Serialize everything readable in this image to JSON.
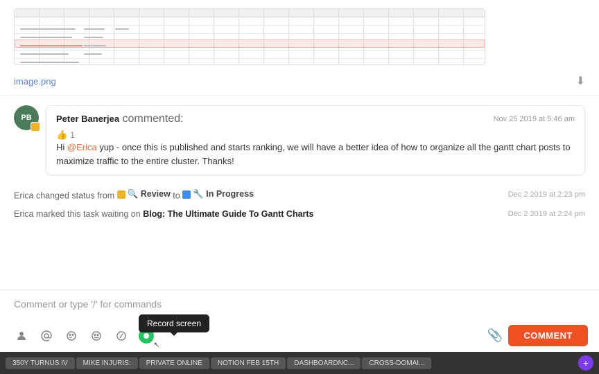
{
  "image": {
    "filename": "image.png",
    "download_label": "⬇"
  },
  "comment": {
    "avatar_initials": "PB",
    "commenter_name": "Peter Banerjea",
    "action": "commented:",
    "timestamp": "Nov 25 2019 at 5:46 am",
    "text_before_mention": "Hi ",
    "mention": "@Erica",
    "text_after_mention": " yup - once this is published and starts ranking, we will have a better idea of how to organize all the gantt chart posts to maximize traffic to the entire cluster. Thanks!",
    "like_count": "1"
  },
  "activity": [
    {
      "text_start": "Erica changed status from",
      "from_status": "Review",
      "to_word": "to",
      "to_status": "In Progress",
      "timestamp": "Dec 2 2019 at 2:23 pm"
    },
    {
      "text_start": "Erica marked this task waiting on",
      "task_link": "Blog: The Ultimate Guide To Gantt Charts",
      "timestamp": "Dec 2 2019 at 2:24 pm"
    }
  ],
  "comment_input": {
    "placeholder": "Comment or type '/' for commands",
    "submit_label": "COMMENT"
  },
  "toolbar": {
    "icons": [
      {
        "name": "person-icon",
        "symbol": "👤"
      },
      {
        "name": "mention-icon",
        "symbol": "@"
      },
      {
        "name": "emoji-smile-icon",
        "symbol": "🙂"
      },
      {
        "name": "emoji-happy-icon",
        "symbol": "😊"
      },
      {
        "name": "slash-command-icon",
        "symbol": "/"
      },
      {
        "name": "record-screen-icon",
        "symbol": "record"
      }
    ],
    "attach_icon": "📎"
  },
  "tooltip": {
    "label": "Record screen"
  },
  "taskbar": {
    "items": [
      {
        "label": "350Y TURNUS IV",
        "active": false
      },
      {
        "label": "MIKE INJURIS:",
        "active": false
      },
      {
        "label": "PRIVATE ONLINE",
        "active": false
      },
      {
        "label": "NOTION FEB 15TH",
        "active": false
      },
      {
        "label": "DASHBOARDNC...",
        "active": false
      },
      {
        "label": "CROSS-DOMAI...",
        "active": false
      }
    ],
    "plus_label": "+"
  }
}
